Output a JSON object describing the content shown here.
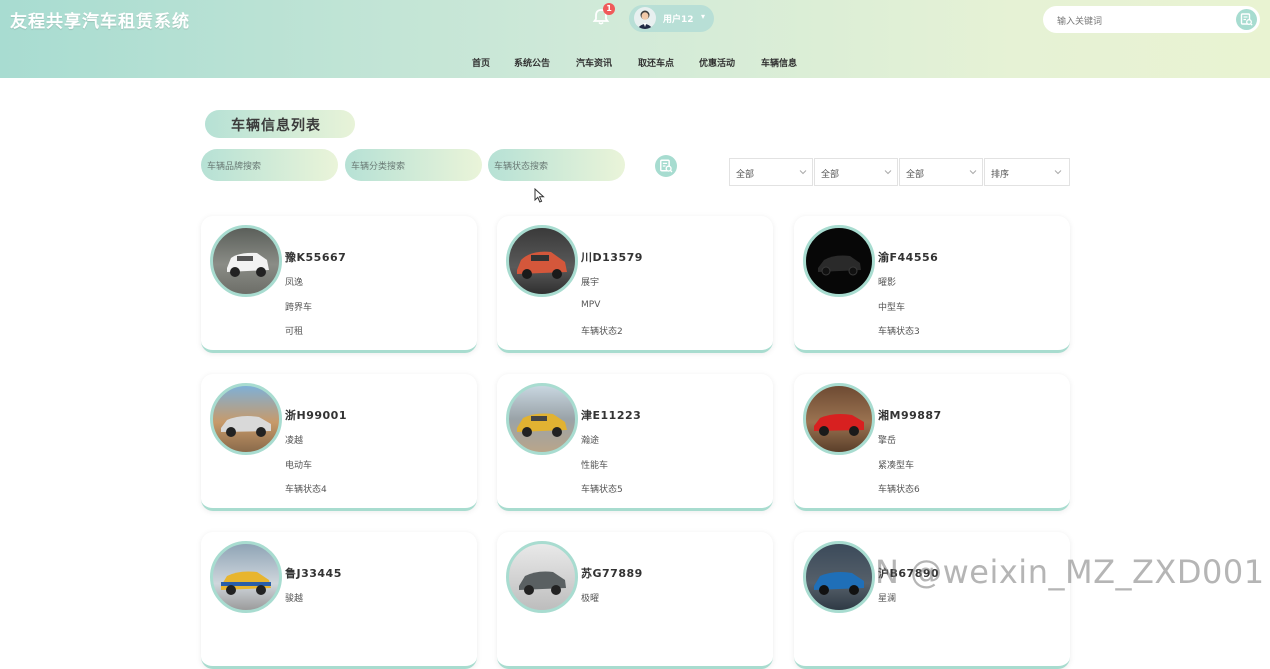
{
  "header": {
    "brand": "友程共享汽车租赁系统",
    "notification_count": "1",
    "user_name": "用户12",
    "user_caret": "▾",
    "search_placeholder": "输入关键词"
  },
  "nav": {
    "items": [
      {
        "label": "首页"
      },
      {
        "label": "系统公告"
      },
      {
        "label": "汽车资讯"
      },
      {
        "label": "取还车点"
      },
      {
        "label": "优惠活动"
      },
      {
        "label": "车辆信息"
      }
    ]
  },
  "main": {
    "title": "车辆信息列表",
    "filters": {
      "brand_placeholder": "车辆品牌搜索",
      "category_placeholder": "车辆分类搜索",
      "status_placeholder": "车辆状态搜索"
    },
    "selects": [
      "全部",
      "全部",
      "全部",
      "排序"
    ]
  },
  "cars": [
    {
      "plate": "豫K55667",
      "brand": "凤逸",
      "category": "跨界车",
      "status": "可租"
    },
    {
      "plate": "川D13579",
      "brand": "展宇",
      "category": "MPV",
      "status": "车辆状态2"
    },
    {
      "plate": "渝F44556",
      "brand": "曜影",
      "category": "中型车",
      "status": "车辆状态3"
    },
    {
      "plate": "浙H99001",
      "brand": "凌越",
      "category": "电动车",
      "status": "车辆状态4"
    },
    {
      "plate": "津E11223",
      "brand": "瀚途",
      "category": "性能车",
      "status": "车辆状态5"
    },
    {
      "plate": "湘M99887",
      "brand": "擎岳",
      "category": "紧凑型车",
      "status": "车辆状态6"
    },
    {
      "plate": "鲁J33445",
      "brand": "骏越",
      "category": "",
      "status": ""
    },
    {
      "plate": "苏G77889",
      "brand": "极曜",
      "category": "",
      "status": ""
    },
    {
      "plate": "沪B67890",
      "brand": "星澜",
      "category": "",
      "status": ""
    }
  ],
  "watermark": "N @weixin_MZ_ZXD001",
  "colors": {
    "accent": "#a8dcd0",
    "badge": "#f05a5a",
    "header_start": "#a8dcd1",
    "header_end": "#e9f3d2"
  }
}
